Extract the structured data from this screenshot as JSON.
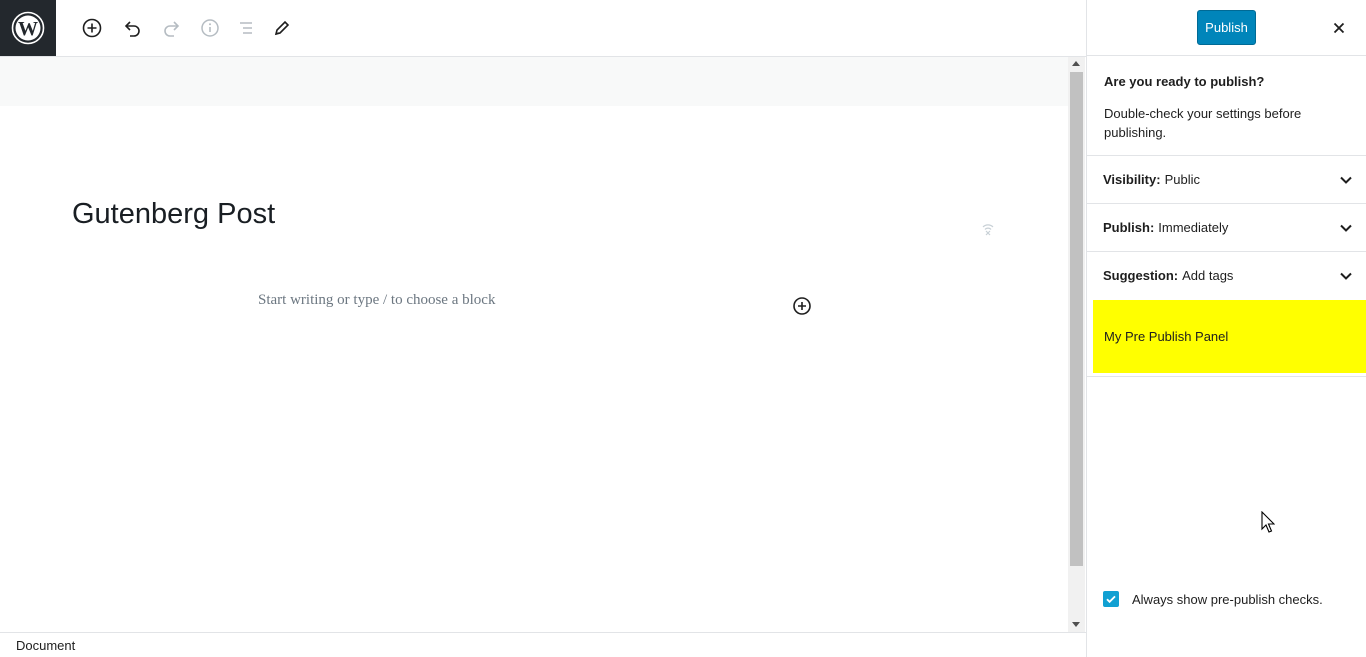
{
  "toolbar": {
    "logo_icon": "wordpress-logo-icon",
    "add_block_icon": "plus-circle-icon",
    "undo_icon": "undo-icon",
    "redo_icon": "redo-icon",
    "info_icon": "info-icon",
    "outline_icon": "list-view-icon",
    "tools_icon": "pencil-icon"
  },
  "editor": {
    "title": "Gutenberg Post",
    "placeholder": "Start writing or type / to choose a block"
  },
  "footer": {
    "breadcrumb": "Document"
  },
  "sidebar": {
    "publish_label": "Publish",
    "close_icon": "close-icon",
    "heading": "Are you ready to publish?",
    "description": "Double-check your settings before publishing.",
    "panels": [
      {
        "label": "Visibility:",
        "value": "Public"
      },
      {
        "label": "Publish:",
        "value": "Immediately"
      },
      {
        "label": "Suggestion:",
        "value": "Add tags"
      }
    ],
    "custom_panel": "My Pre Publish Panel",
    "always_show_label": "Always show pre-publish checks.",
    "always_show_checked": true
  },
  "colors": {
    "accent": "#0085ba",
    "custom_panel_bg": "#ffff00",
    "checkbox": "#11a0d2",
    "logo_bg": "#23282d"
  }
}
